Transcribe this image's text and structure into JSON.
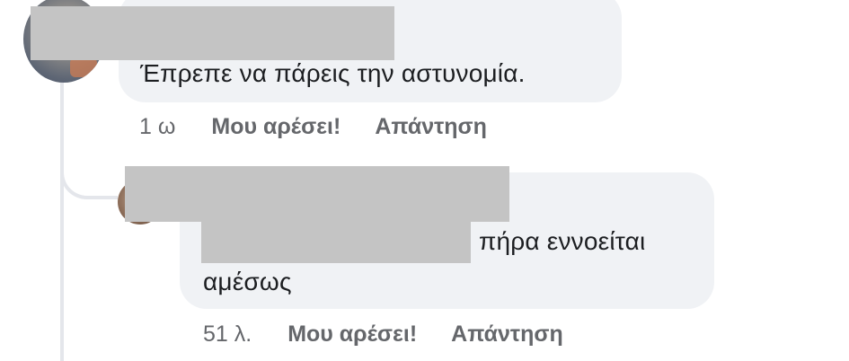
{
  "comments": [
    {
      "author_redacted": true,
      "text": "Έπρεπε να πάρεις την αστυνομία.",
      "time": "1 ω",
      "like_label": "Μου αρέσει!",
      "reply_label": "Απάντηση"
    },
    {
      "author_redacted": true,
      "mention_redacted": true,
      "text_line1": "πήρα  εννοείται",
      "text_line2": "αμέσως",
      "time": "51 λ.",
      "like_label": "Μου αρέσει!",
      "reply_label": "Απάντηση"
    }
  ],
  "colors": {
    "bubble_bg": "#f0f2f5",
    "text": "#1c1e21",
    "meta_text": "#65676b",
    "redaction": "#c4c4c4",
    "thread_line": "#e4e6eb"
  }
}
